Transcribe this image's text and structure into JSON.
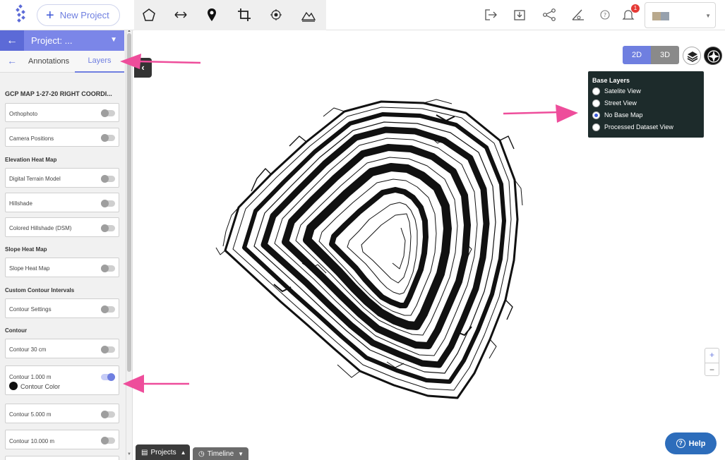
{
  "topbar": {
    "new_project_label": "New Project",
    "notification_count": "1",
    "tools": [
      "polygon-tool",
      "measure-distance-tool",
      "location-pin-tool",
      "crop-tool",
      "target-tool",
      "elevation-profile-tool"
    ],
    "right_icons": [
      "export-icon",
      "download-icon",
      "share-icon",
      "measure-icon",
      "help-circle-icon",
      "bell-icon"
    ]
  },
  "sidebar": {
    "project_title": "Project: ...",
    "tabs": {
      "annotations": "Annotations",
      "layers": "Layers",
      "active": "Layers"
    },
    "dataset_title": "GCP MAP 1-27-20 RIGHT COORDI...",
    "items": [
      {
        "label": "Orthophoto",
        "on": false
      },
      {
        "label": "Camera Positions",
        "on": false
      },
      {
        "label": "Digital Terrain Model",
        "on": false
      },
      {
        "label": "Hillshade",
        "on": false
      },
      {
        "label": "Colored Hillshade (DSM)",
        "on": false
      },
      {
        "label": "Slope Heat Map",
        "on": false
      },
      {
        "label": "Contour Settings",
        "on": false
      },
      {
        "label": "Contour 30 cm",
        "on": false
      },
      {
        "label": "Contour 1.000 m",
        "on": true,
        "color_label": "Contour Color",
        "color": "#111111"
      },
      {
        "label": "Contour 5.000 m",
        "on": false
      },
      {
        "label": "Contour 10.000 m",
        "on": false
      }
    ],
    "sections": [
      "Elevation Heat Map",
      "Slope Heat Map",
      "Custom Contour Intervals",
      "Contour"
    ]
  },
  "map": {
    "view_2d": "2D",
    "view_3d": "3D",
    "active_view": "2D",
    "base_layers": {
      "title": "Base Layers",
      "options": [
        "Satelite View",
        "Street View",
        "No Base Map",
        "Processed Dataset View"
      ],
      "selected": "No Base Map"
    },
    "zoom_in": "+",
    "zoom_out": "−"
  },
  "bottom": {
    "projects_label": "Projects",
    "timeline_label": "Timeline"
  },
  "help_label": "Help",
  "colors": {
    "accent": "#6f7fe0",
    "arrow": "#ee4d9b",
    "panel": "#1d2b2b",
    "help": "#2d6dbb"
  }
}
